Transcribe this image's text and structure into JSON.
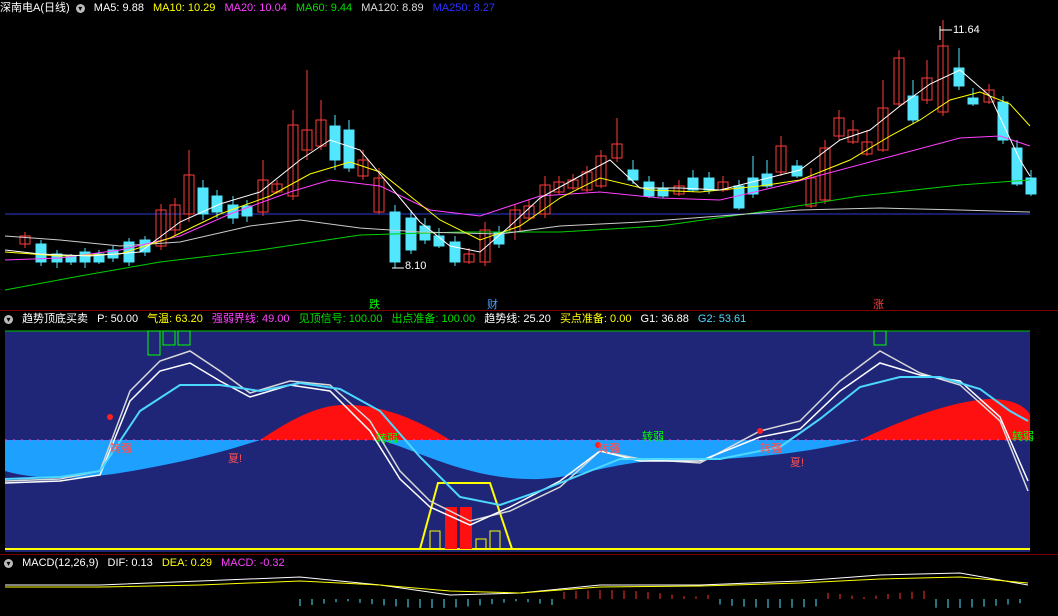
{
  "price_panel": {
    "title": "深南电A(日线)",
    "indicators": [
      {
        "label": "MA5: 9.88",
        "color": "#ffffff"
      },
      {
        "label": "MA10: 10.29",
        "color": "#ffff00"
      },
      {
        "label": "MA20: 10.04",
        "color": "#ff40ff"
      },
      {
        "label": "MA60: 9.44",
        "color": "#00e000"
      },
      {
        "label": "MA120: 8.89",
        "color": "#dddddd"
      },
      {
        "label": "MA250: 8.27",
        "color": "#3030ff"
      }
    ],
    "high_label": "11.64",
    "low_label": "8.10",
    "markers": [
      {
        "text": "跌",
        "color": "#00ff00"
      },
      {
        "text": "财",
        "color": "#4aa0ff"
      },
      {
        "text": "涨",
        "color": "#ff4040"
      }
    ]
  },
  "trend_panel": {
    "title": "趋势顶底买卖",
    "indicators": [
      {
        "label": "P: 50.00",
        "color": "#ffffff"
      },
      {
        "label": "气温: 63.20",
        "color": "#ffff00"
      },
      {
        "label": "强弱界线: 49.00",
        "color": "#ff40ff"
      },
      {
        "label": "见顶信号: 100.00",
        "color": "#00e000"
      },
      {
        "label": "出点准备: 100.00",
        "color": "#00e000"
      },
      {
        "label": "趋势线: 25.20",
        "color": "#ffffff"
      },
      {
        "label": "买点准备: 0.00",
        "color": "#ffff00"
      },
      {
        "label": "G1: 36.88",
        "color": "#ffffff"
      },
      {
        "label": "G2: 53.61",
        "color": "#4dd8ff"
      }
    ],
    "labels": {
      "turn_strong": "转强",
      "turn_weak": "转弱",
      "summer": "夏!"
    }
  },
  "macd_panel": {
    "title": "MACD(12,26,9)",
    "indicators": [
      {
        "label": "DIF: 0.13",
        "color": "#ffffff"
      },
      {
        "label": "DEA: 0.29",
        "color": "#ffff00"
      },
      {
        "label": "MACD: -0.32",
        "color": "#ff40ff"
      }
    ]
  }
}
